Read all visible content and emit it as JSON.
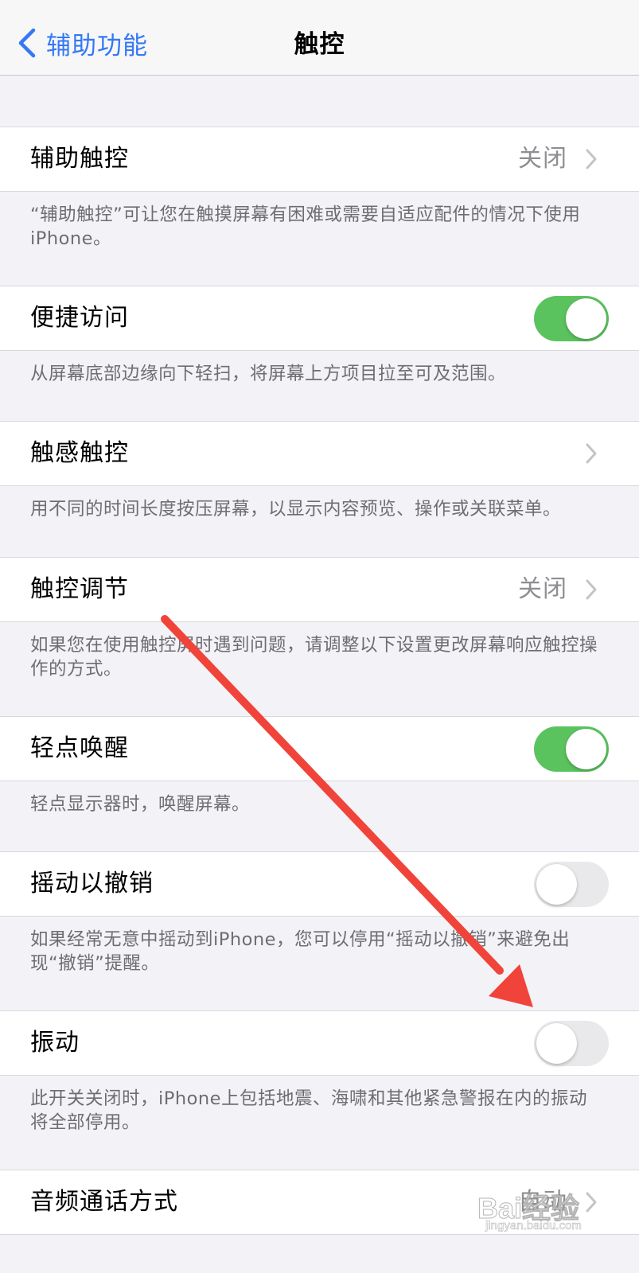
{
  "navbar": {
    "back_label": "辅助功能",
    "title": "触控"
  },
  "rows": [
    {
      "label": "辅助触控",
      "value": "关闭",
      "control": "chevron",
      "description": "“辅助触控”可让您在触摸屏幕有困难或需要自适应配件的情况下使用iPhone。"
    },
    {
      "label": "便捷访问",
      "control": "toggle",
      "toggle_on": true,
      "description": "从屏幕底部边缘向下轻扫，将屏幕上方项目拉至可及范围。"
    },
    {
      "label": "触感触控",
      "value": "",
      "control": "chevron",
      "description": "用不同的时间长度按压屏幕，以显示内容预览、操作或关联菜单。"
    },
    {
      "label": "触控调节",
      "value": "关闭",
      "control": "chevron",
      "description": "如果您在使用触控屏时遇到问题，请调整以下设置更改屏幕响应触控操作的方式。"
    },
    {
      "label": "轻点唤醒",
      "control": "toggle",
      "toggle_on": true,
      "description": "轻点显示器时，唤醒屏幕。"
    },
    {
      "label": "摇动以撤销",
      "control": "toggle",
      "toggle_on": false,
      "description": "如果经常无意中摇动到iPhone，您可以停用“摇动以撤销”来避免出现“撤销”提醒。"
    },
    {
      "label": "振动",
      "control": "toggle",
      "toggle_on": false,
      "description": "此开关关闭时，iPhone上包括地震、海啸和其他紧急警报在内的振动将全部停用。"
    },
    {
      "label": "音频通话方式",
      "value": "自动",
      "control": "chevron"
    }
  ],
  "watermark": {
    "main": "Bai经验",
    "sub": "jingyan.baidu.com"
  },
  "colors": {
    "accent": "#3478f6",
    "toggle_on": "#5ac35e",
    "toggle_off": "#e9e9eb",
    "annotation_arrow": "#f0443a"
  }
}
